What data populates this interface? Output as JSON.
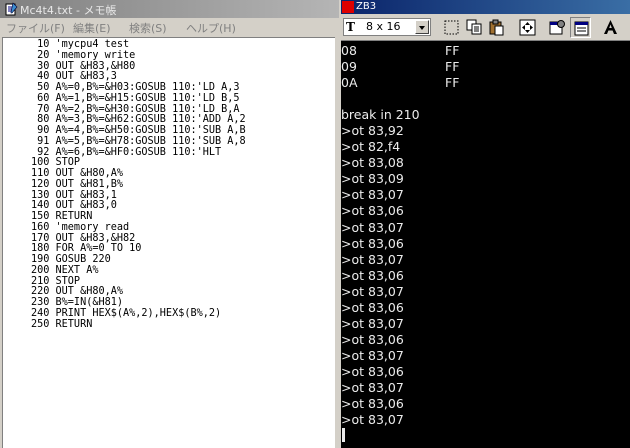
{
  "notepad": {
    "title": "Mc4t4.txt - メモ帳",
    "menu": [
      "ファイル(F)",
      "編集(E)",
      "検索(S)",
      "ヘルプ(H)"
    ],
    "lines": [
      "10 'mycpu4 test",
      "20 'memory write",
      "30 OUT &H83,&H80",
      "40 OUT &H83,3",
      "50 A%=0,B%=&H03:GOSUB 110:'LD A,3",
      "60 A%=1,B%=&H15:GOSUB 110:'LD B,5",
      "70 A%=2,B%=&H30:GOSUB 110:'LD B,A",
      "80 A%=3,B%=&H62:GOSUB 110:'ADD A,2",
      "90 A%=4,B%=&H50:GOSUB 110:'SUB A,B",
      "91 A%=5,B%=&H78:GOSUB 110:'SUB A,8",
      "92 A%=6,B%=&HF0:GOSUB 110:'HLT",
      "100 STOP",
      "110 OUT &H80,A%",
      "120 OUT &H81,B%",
      "130 OUT &H83,1",
      "140 OUT &H83,0",
      "150 RETURN",
      "160 'memory read",
      "170 OUT &H83,&H82",
      "180 FOR A%=0 TO 10",
      "190 GOSUB 220",
      "200 NEXT A%",
      "210 STOP",
      "220 OUT &H80,A%",
      "230 B%=IN(&H81)",
      "240 PRINT HEX$(A%,2),HEX$(B%,2)",
      "250 RETURN"
    ]
  },
  "terminal": {
    "title": "ZB3",
    "font_size": "8 x 16",
    "toolbar_icons": [
      "select-icon",
      "copy-icon",
      "paste-icon",
      "fullscreen-icon",
      "properties-icon",
      "background-icon",
      "font-icon"
    ],
    "dump_rows": [
      {
        "addr": "08",
        "val": "FF"
      },
      {
        "addr": "09",
        "val": "FF"
      },
      {
        "addr": "0A",
        "val": "FF"
      }
    ],
    "blank_line": "",
    "lines": [
      "break in 210",
      ">ot 83,92",
      ">ot 82,f4",
      ">ot 83,08",
      ">ot 83,09",
      ">ot 83,07",
      ">ot 83,06",
      ">ot 83,07",
      ">ot 83,06",
      ">ot 83,07",
      ">ot 83,06",
      ">ot 83,07",
      ">ot 83,06",
      ">ot 83,07",
      ">ot 83,06",
      ">ot 83,07",
      ">ot 83,06",
      ">ot 83,07",
      ">ot 83,06",
      ">ot 83,07"
    ]
  },
  "colors": {
    "notepad_title_bar": "#808080",
    "terminal_title_bar": "#0a246a",
    "terminal_bg": "#000000",
    "terminal_text": "#ececec"
  }
}
